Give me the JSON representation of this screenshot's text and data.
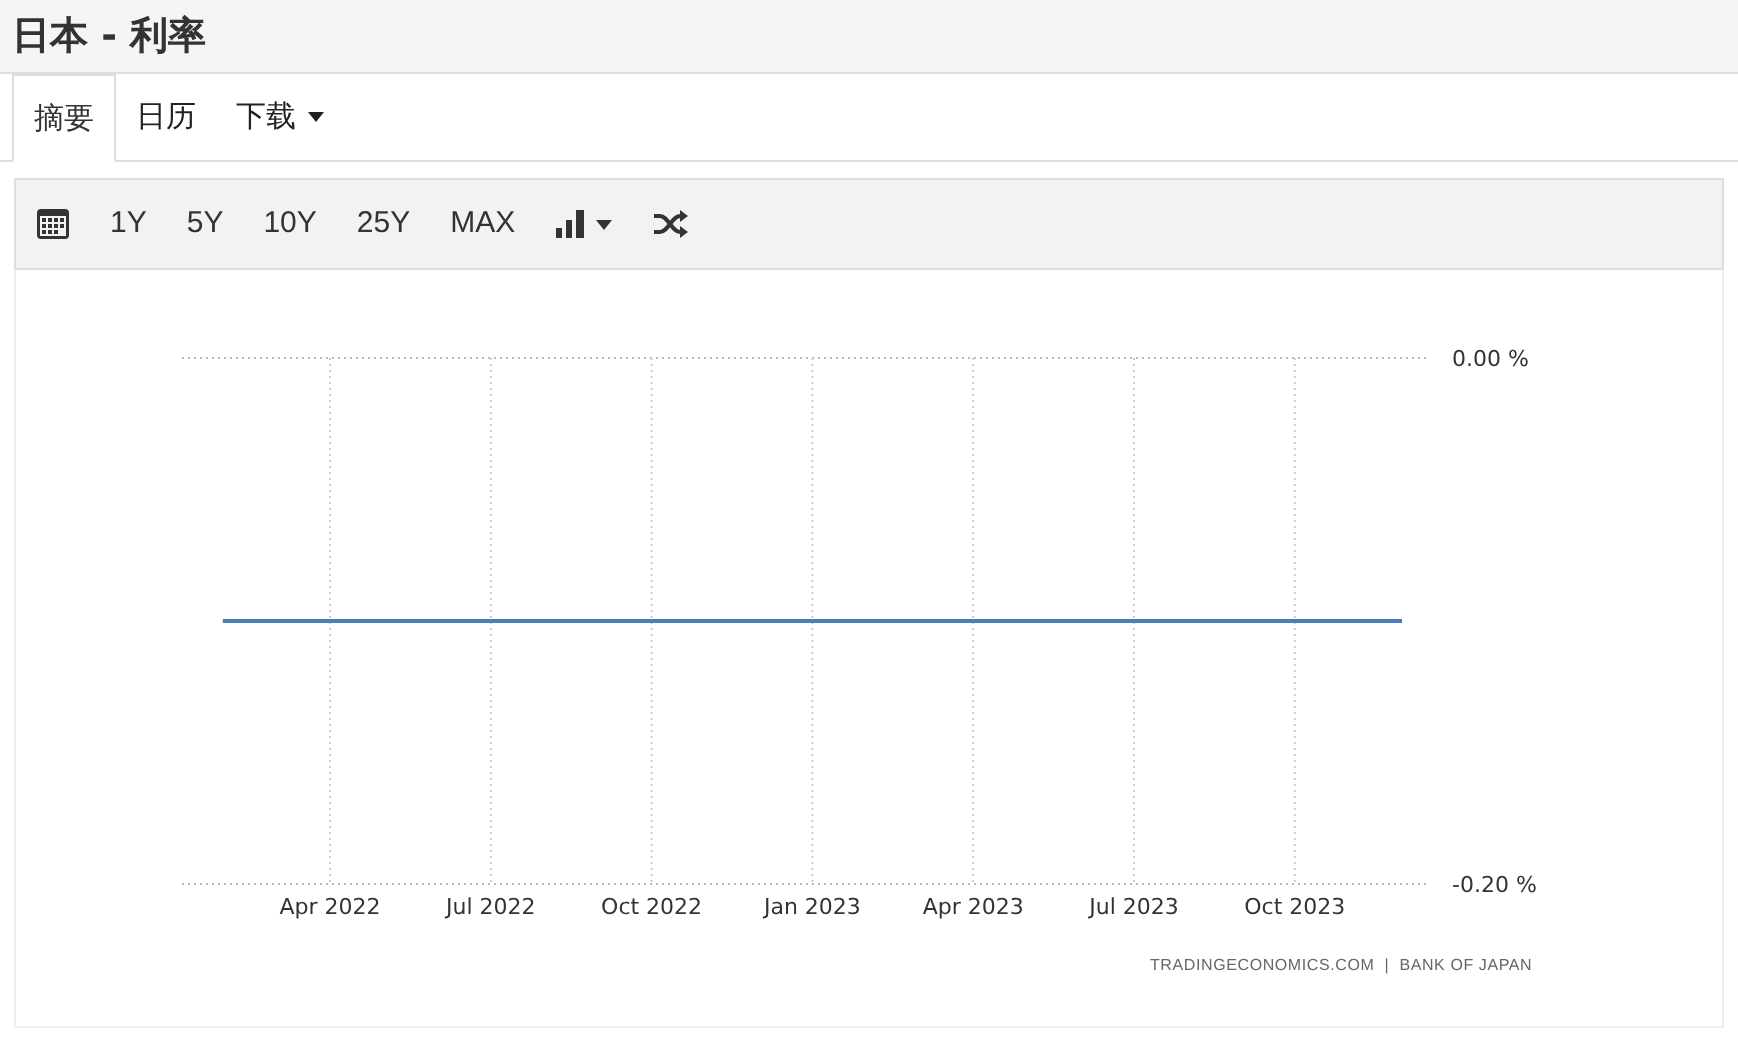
{
  "title": "日本 - 利率",
  "tabs": [
    {
      "label": "摘要",
      "selected": true
    },
    {
      "label": "日历",
      "selected": false
    },
    {
      "label": "下载",
      "selected": false,
      "dropdown": true
    }
  ],
  "toolbar": [
    {
      "kind": "calendar"
    },
    {
      "kind": "text",
      "label": "1Y"
    },
    {
      "kind": "text",
      "label": "5Y"
    },
    {
      "kind": "text",
      "label": "10Y"
    },
    {
      "kind": "text",
      "label": "25Y"
    },
    {
      "kind": "text",
      "label": "MAX"
    },
    {
      "kind": "charttype"
    },
    {
      "kind": "shuffle"
    }
  ],
  "chart": {
    "chart_data": {
      "type": "line",
      "categories": [
        null,
        null,
        "Apr 2022",
        null,
        null,
        "Jul 2022",
        null,
        null,
        "Oct 2022",
        null,
        null,
        "Jan 2023",
        null,
        null,
        "Apr 2023",
        null,
        null,
        "Jul 2023",
        null,
        null,
        "Oct 2023",
        null,
        null
      ],
      "series": [
        {
          "color": "#4a7ebb",
          "values": [
            -0.1,
            -0.1,
            -0.1,
            -0.1,
            -0.1,
            -0.1,
            -0.1,
            -0.1,
            -0.1,
            -0.1,
            -0.1,
            -0.1,
            -0.1,
            -0.1,
            -0.1,
            -0.1,
            -0.1,
            -0.1,
            -0.1,
            -0.1,
            -0.1,
            -0.1,
            -0.1
          ]
        }
      ],
      "yticks": [
        {
          "value": 0,
          "label": "0.00 %"
        },
        {
          "value": -0.2,
          "label": "-0.20 %"
        }
      ],
      "ylim": [
        -0.2,
        0
      ],
      "grid": true
    },
    "source": "TRADINGECONOMICS.COM  |  BANK OF JAPAN"
  }
}
